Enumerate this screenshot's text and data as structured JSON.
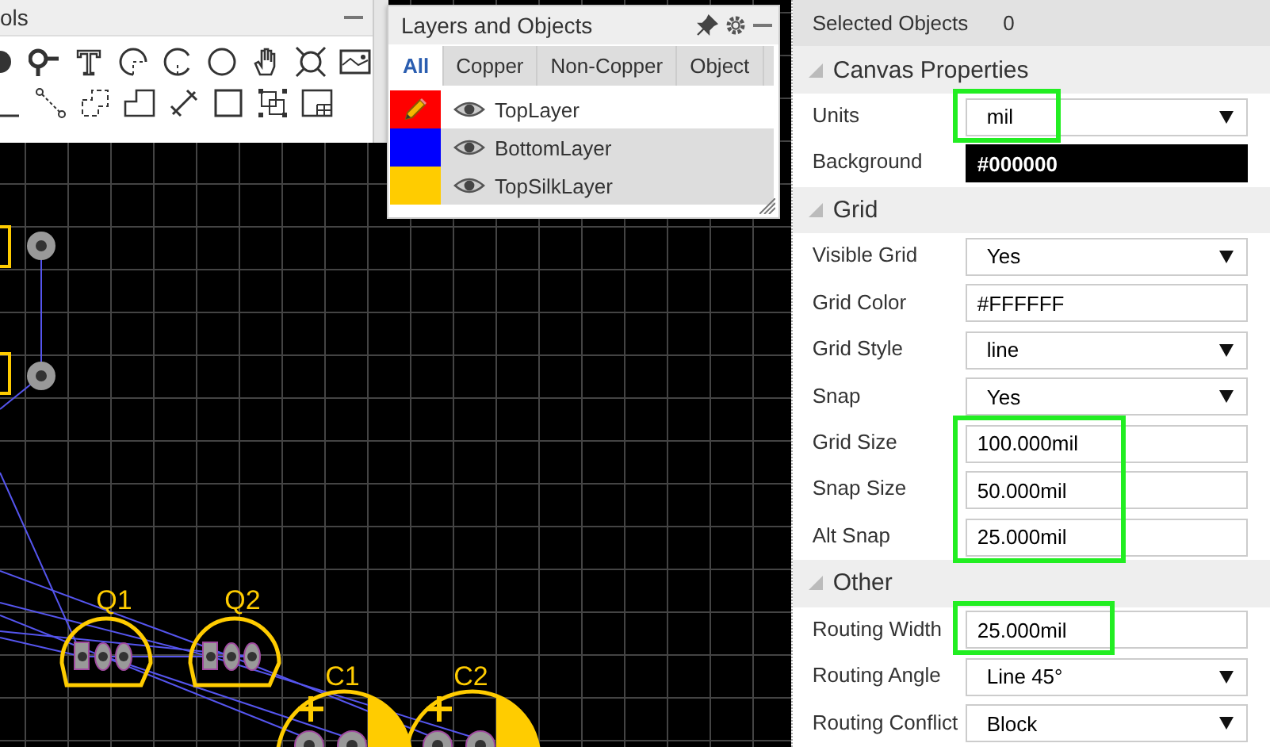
{
  "tools_panel": {
    "title": "ols",
    "rows": [
      [
        {
          "kind": "probe-dot"
        },
        {
          "kind": "pin"
        },
        {
          "kind": "text"
        },
        {
          "kind": "arc-center"
        },
        {
          "kind": "arc-3pt"
        },
        {
          "kind": "circle"
        },
        {
          "kind": "hand"
        },
        {
          "kind": "cross-circle"
        },
        {
          "kind": "image"
        }
      ],
      [
        {
          "kind": "line"
        },
        {
          "kind": "connector"
        },
        {
          "kind": "dashed-rect"
        },
        {
          "kind": "polygon"
        },
        {
          "kind": "dimension"
        },
        {
          "kind": "rectangle"
        },
        {
          "kind": "align"
        },
        {
          "kind": "table"
        }
      ]
    ]
  },
  "layers_panel": {
    "title": "Layers and Objects",
    "tabs": [
      {
        "label": "All",
        "selected": true
      },
      {
        "label": "Copper",
        "selected": false
      },
      {
        "label": "Non-Copper",
        "selected": false
      },
      {
        "label": "Object",
        "selected": false
      }
    ],
    "layers": [
      {
        "name": "TopLayer",
        "color": "#ff0000",
        "active": true,
        "visible": true
      },
      {
        "name": "BottomLayer",
        "color": "#0000ff",
        "active": false,
        "visible": true
      },
      {
        "name": "TopSilkLayer",
        "color": "#ffcc00",
        "active": false,
        "visible": true
      }
    ]
  },
  "canvas": {
    "labels": [
      "Q1",
      "Q2",
      "C1",
      "C2"
    ]
  },
  "properties": {
    "selected_label": "Selected Objects",
    "selected_count": "0",
    "sections": [
      {
        "title": "Canvas Properties",
        "expanded": true,
        "rows": [
          {
            "label": "Units",
            "kind": "select",
            "value": "mil",
            "highlighted": true
          },
          {
            "label": "Background",
            "kind": "swatch",
            "value": "#000000",
            "color": "#000000",
            "highlighted": false
          }
        ]
      },
      {
        "title": "Grid",
        "expanded": true,
        "rows": [
          {
            "label": "Visible Grid",
            "kind": "select",
            "value": "Yes",
            "highlighted": false
          },
          {
            "label": "Grid Color",
            "kind": "swatch",
            "value": "#FFFFFF",
            "color": "#ffffff",
            "highlighted": false
          },
          {
            "label": "Grid Style",
            "kind": "select",
            "value": "line",
            "highlighted": false
          },
          {
            "label": "Snap",
            "kind": "select",
            "value": "Yes",
            "highlighted": false
          },
          {
            "label": "Grid Size",
            "kind": "text",
            "value": "100.000mil",
            "highlighted": true
          },
          {
            "label": "Snap Size",
            "kind": "text",
            "value": "50.000mil",
            "highlighted": true
          },
          {
            "label": "Alt Snap",
            "kind": "text",
            "value": "25.000mil",
            "highlighted": true
          }
        ]
      },
      {
        "title": "Other",
        "expanded": true,
        "rows": [
          {
            "label": "Routing Width",
            "kind": "text",
            "value": "25.000mil",
            "highlighted": true
          },
          {
            "label": "Routing Angle",
            "kind": "select",
            "value": "Line 45°",
            "highlighted": false
          },
          {
            "label": "Routing Conflict",
            "kind": "select",
            "value": "Block",
            "highlighted": false
          }
        ]
      }
    ]
  }
}
